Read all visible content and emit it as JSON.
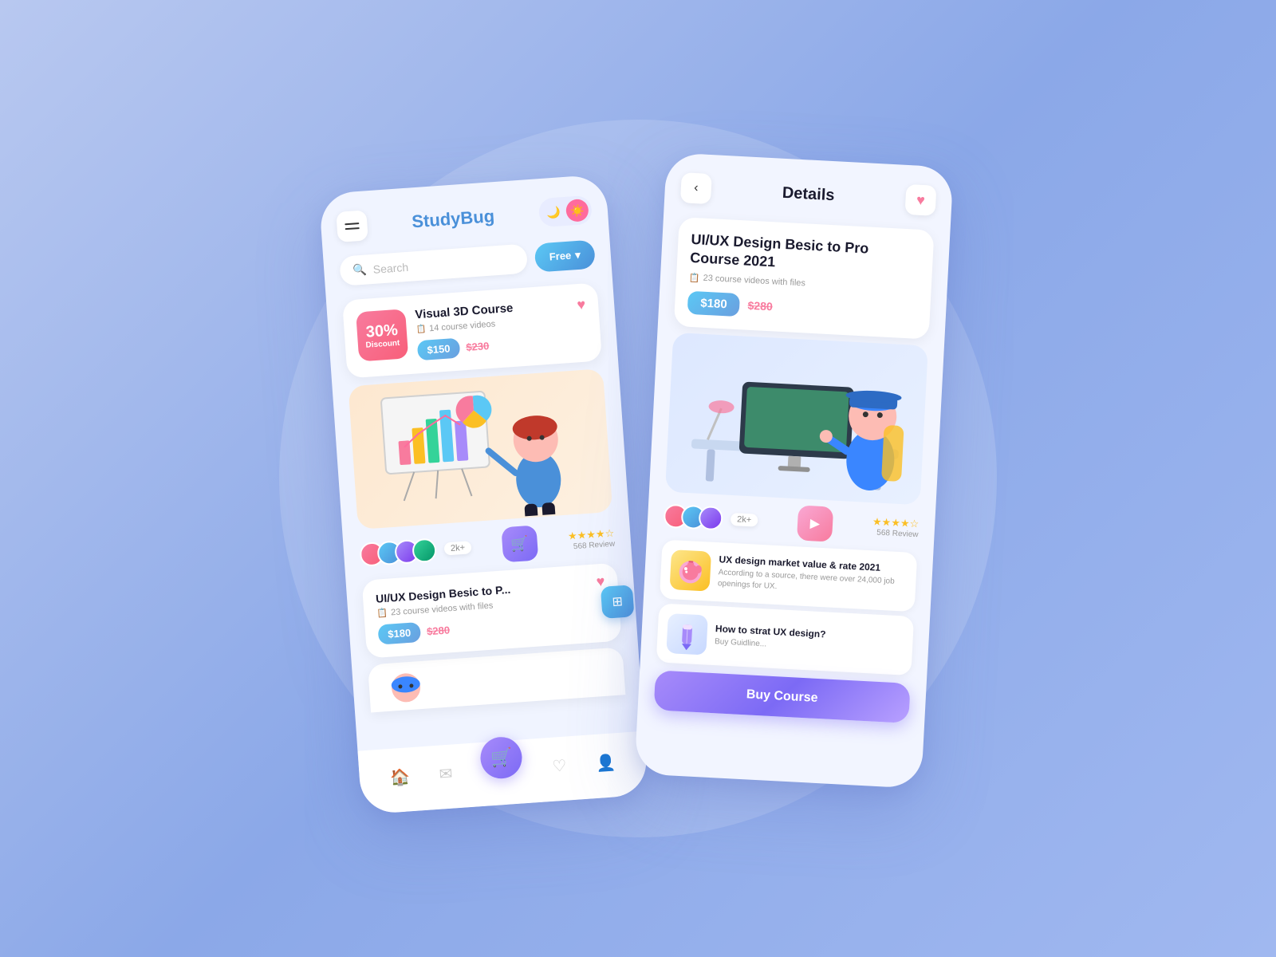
{
  "background": "#a0b8f0",
  "left_phone": {
    "logo": {
      "text_black": "Study",
      "text_blue": "Bug"
    },
    "theme_toggle": {
      "moon": "🌙",
      "sun": "☀️"
    },
    "search": {
      "placeholder": "Search"
    },
    "free_button": {
      "label": "Free",
      "arrow": "▾"
    },
    "featured_card": {
      "discount": "30%",
      "discount_label": "Discount",
      "title": "Visual 3D Course",
      "meta": "14 course videos",
      "price": "$150",
      "old_price": "$230"
    },
    "stats": {
      "count": "2k+",
      "stars": "★★★★☆",
      "review": "568 Review"
    },
    "course_card_2": {
      "title": "UI/UX Design Besic to P...",
      "meta": "23 course videos with files",
      "price": "$180",
      "old_price": "$280"
    },
    "bottom_nav": {
      "home": "🏠",
      "mail": "✉",
      "cart": "🛒",
      "heart": "♡",
      "user": "👤"
    }
  },
  "right_phone": {
    "header": {
      "back": "‹",
      "title": "Details"
    },
    "course": {
      "title": "UI/UX Design Besic to Pro Course 2021",
      "meta": "23 course videos with files",
      "price": "$180",
      "old_price": "$280"
    },
    "stats": {
      "count": "2k+",
      "stars": "★★★★☆",
      "review": "568 Review"
    },
    "blog_1": {
      "title": "UX design market value & rate 2021",
      "desc": "According to a source, there were over 24,000 job openings for UX."
    },
    "blog_2": {
      "title": "How to strat UX design?",
      "desc": "Buy Guidline..."
    },
    "buy_button": "Buy Course"
  }
}
